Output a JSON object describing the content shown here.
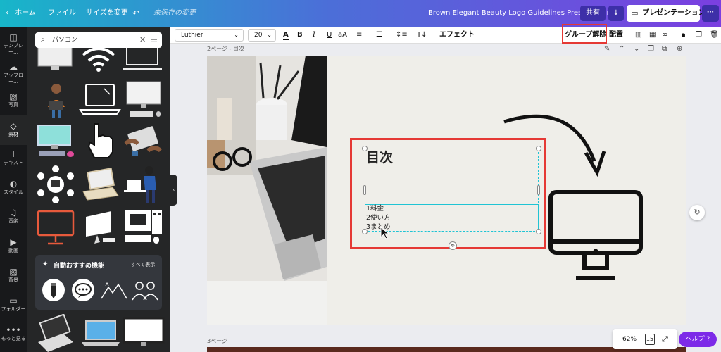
{
  "topbar": {
    "back_label": "ホーム",
    "file_label": "ファイル",
    "resize_label": "サイズを変更",
    "unsaved_label": "未保存の変更",
    "doc_title": "Brown Elegant Beauty Logo Guidelines Presentation",
    "share_label": "共有",
    "present_label": "プレゼンテーション"
  },
  "rail": {
    "items": [
      {
        "label": "テンプレー…"
      },
      {
        "label": "アップロー…"
      },
      {
        "label": "写真"
      },
      {
        "label": "素材"
      },
      {
        "label": "テキスト"
      },
      {
        "label": "スタイル"
      },
      {
        "label": "音楽"
      },
      {
        "label": "動画"
      },
      {
        "label": "背景"
      },
      {
        "label": "フォルダー"
      },
      {
        "label": "もっと見る"
      }
    ]
  },
  "panel": {
    "search_value": "パソコン",
    "ai_title": "自動おすすめ機能",
    "ai_see_all": "すべて表示"
  },
  "toolbar": {
    "font": "Luthier",
    "size": "20",
    "bold": "B",
    "italic": "I",
    "underline": "U",
    "case": "aA",
    "effects": "エフェクト",
    "ungroup": "グループ解除",
    "position": "配置"
  },
  "canvas": {
    "page_label": "2ページ - 目次",
    "next_page_label": "3ページ",
    "heading": "目次",
    "list": [
      "1料金",
      "2使い方",
      "3まとめ"
    ]
  },
  "footer": {
    "zoom": "62%",
    "page_count": "15",
    "help_label": "ヘルプ ?"
  },
  "colors": {
    "accent_purple": "#7d2ae8",
    "annotation_red": "#e53935",
    "selection_teal": "#20c4d4"
  }
}
